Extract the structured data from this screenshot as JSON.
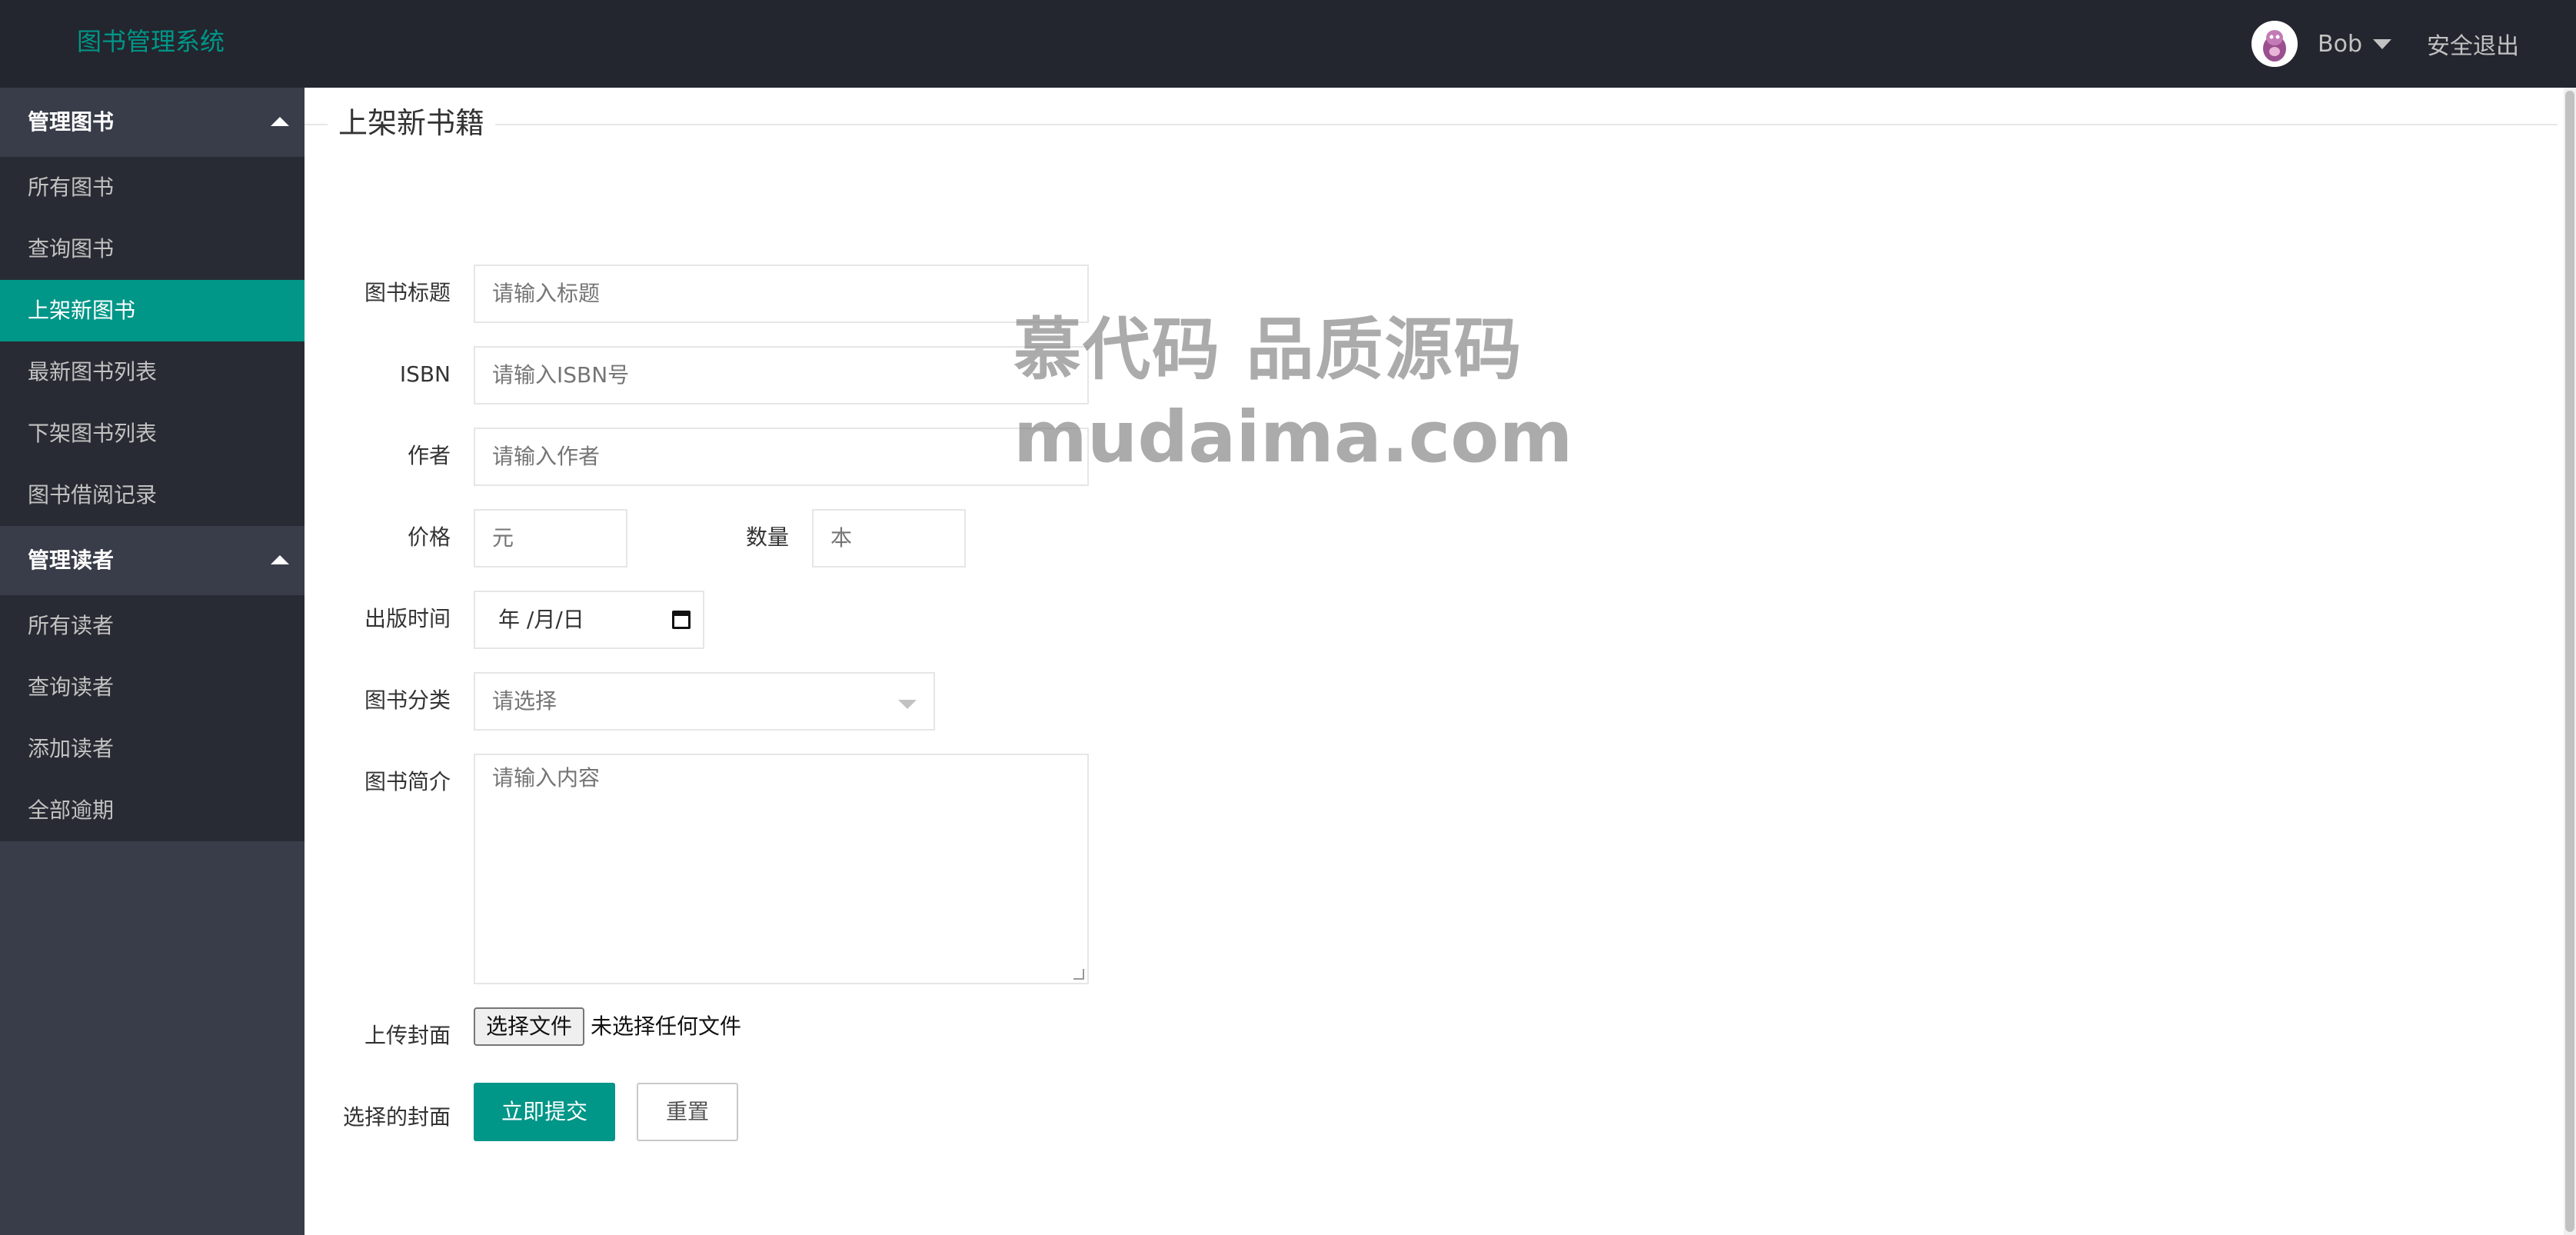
{
  "app": {
    "title": "图书管理系统"
  },
  "header": {
    "user_name": "Bob",
    "logout_label": "安全退出"
  },
  "sidebar": {
    "groups": [
      {
        "title": "管理图书",
        "items": [
          "所有图书",
          "查询图书",
          "上架新图书",
          "最新图书列表",
          "下架图书列表",
          "图书借阅记录"
        ]
      },
      {
        "title": "管理读者",
        "items": [
          "所有读者",
          "查询读者",
          "添加读者",
          "全部逾期"
        ]
      }
    ],
    "active_item": "上架新图书"
  },
  "form": {
    "legend": "上架新书籍",
    "title_label": "图书标题",
    "title_placeholder": "请输入标题",
    "isbn_label": "ISBN",
    "isbn_placeholder": "请输入ISBN号",
    "author_label": "作者",
    "author_placeholder": "请输入作者",
    "price_label": "价格",
    "price_placeholder": "元",
    "quantity_label": "数量",
    "quantity_placeholder": "本",
    "date_label": "出版时间",
    "date_value": "年 /月/日",
    "category_label": "图书分类",
    "category_placeholder": "请选择",
    "summary_label": "图书简介",
    "summary_placeholder": "请输入内容",
    "cover_label": "上传封面",
    "file_button": "选择文件",
    "file_status": "未选择任何文件",
    "selected_cover_label": "选择的封面",
    "submit_label": "立即提交",
    "reset_label": "重置"
  },
  "watermark": {
    "line1": "慕代码 品质源码",
    "line2": "mudaima.com"
  },
  "colors": {
    "header_bg": "#23262e",
    "sidebar_bg": "#393d49",
    "sidebar_sub_bg": "#282b33",
    "accent": "#009688"
  }
}
